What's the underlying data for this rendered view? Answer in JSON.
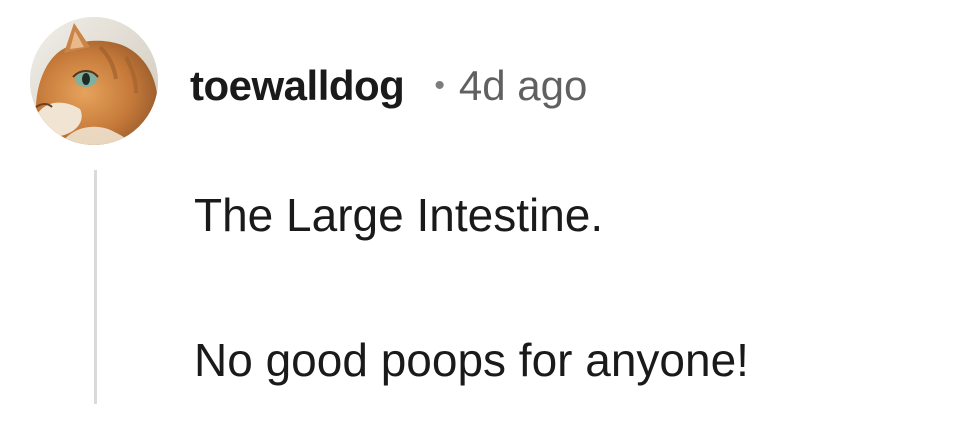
{
  "comment": {
    "author": {
      "username": "toewalldog",
      "avatar_icon": "orange-cat-avatar"
    },
    "separator": "•",
    "timestamp": "4d ago",
    "paragraphs": [
      "The Large Intestine.",
      "No good poops for anyone!"
    ]
  }
}
